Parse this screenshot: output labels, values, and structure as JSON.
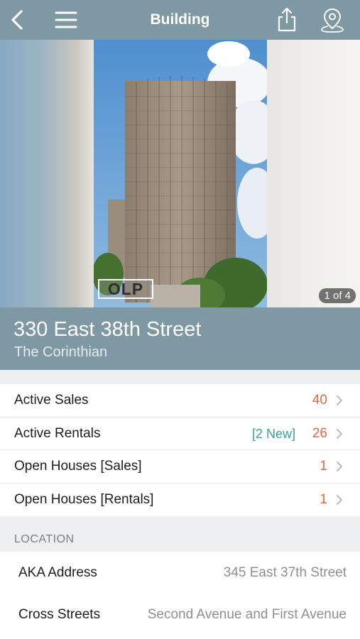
{
  "navbar": {
    "title": "Building",
    "back_icon": "chevron-left-icon",
    "menu_icon": "hamburger-menu-icon",
    "share_icon": "share-icon",
    "map_icon": "map-pin-icon"
  },
  "gallery": {
    "counter": "1 of 4",
    "watermark": "OLP"
  },
  "header": {
    "address": "330 East 38th Street",
    "building_name": "The Corinthian"
  },
  "listings": [
    {
      "label": "Active Sales",
      "new_badge": "",
      "count": "40"
    },
    {
      "label": "Active Rentals",
      "new_badge": "[2 New]",
      "count": "26"
    },
    {
      "label": "Open Houses [Sales]",
      "new_badge": "",
      "count": "1"
    },
    {
      "label": "Open Houses [Rentals]",
      "new_badge": "",
      "count": "1"
    }
  ],
  "location": {
    "section_title": "LOCATION",
    "rows": [
      {
        "label": "AKA Address",
        "value": "345 East 37th Street"
      },
      {
        "label": "Cross Streets",
        "value": "Second Avenue and First Avenue"
      }
    ]
  },
  "colors": {
    "bar": "#7e98a4",
    "count": "#e06a3b",
    "new_badge": "#35a58c",
    "section_bg": "#eeeff0"
  }
}
